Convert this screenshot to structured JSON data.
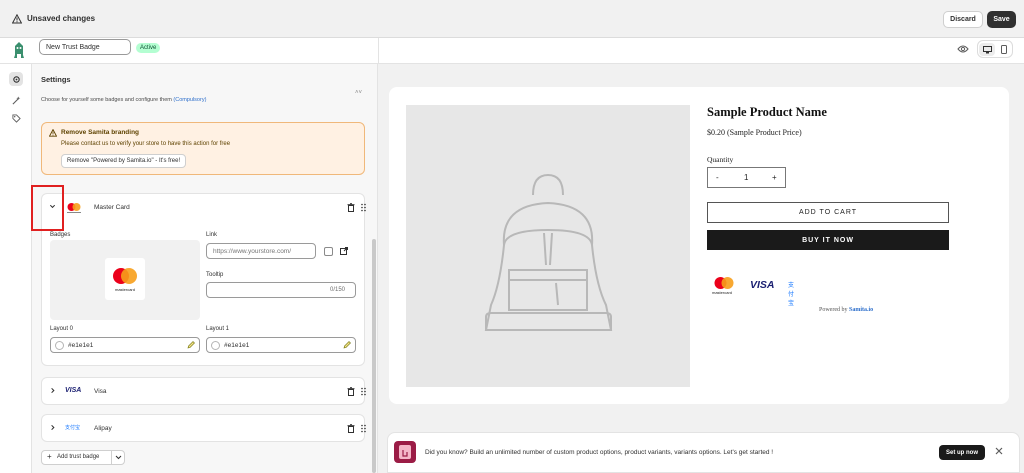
{
  "topbar": {
    "title": "Unsaved changes",
    "discard": "Discard",
    "save": "Save"
  },
  "header": {
    "name_value": "New Trust Badge",
    "status": "Active"
  },
  "rail": {
    "icons": [
      "gear-icon",
      "magic-icon",
      "tag-icon"
    ]
  },
  "settings": {
    "title": "Settings",
    "subtitle": "Choose for yourself some badges and configure them",
    "subtitle_link": "(Compulsory)",
    "notice": {
      "title": "Remove Samita branding",
      "message": "Please contact us to verify your store to have this action for free",
      "button": "Remove \"Powered by Samita.io\" - It's free!"
    },
    "badges": [
      {
        "name": "Master Card",
        "expanded": true,
        "badges_label": "Badges",
        "badge_caption": "mastercard",
        "link_label": "Link",
        "link_placeholder": "https://www.yourstore.com/",
        "tooltip_label": "Tooltip",
        "tooltip_counter": "0/150",
        "layout0_label": "Layout 0",
        "layout0_value": "#e1e1e1",
        "layout1_label": "Layout 1",
        "layout1_value": "#e1e1e1"
      },
      {
        "name": "Visa",
        "expanded": false,
        "logo_text": "VISA"
      },
      {
        "name": "Alipay",
        "expanded": false,
        "logo_text": "支付宝"
      }
    ],
    "add_button": "Add trust badge"
  },
  "preview": {
    "product_name": "Sample Product Name",
    "price": "$0.20 (Sample Product Price)",
    "quantity_label": "Quantity",
    "qty_minus": "-",
    "qty_value": "1",
    "qty_plus": "+",
    "add_to_cart": "ADD TO CART",
    "buy_now": "BUY IT NOW",
    "trust_badges": [
      "mastercard",
      "VISA",
      "支付宝"
    ],
    "powered_prefix": "Powered by",
    "powered_brand": "Samita.io"
  },
  "tip": {
    "text": "Did you know? Build an unlimited number of custom product options, product variants, variants options. Let's get started !",
    "button": "Set up now"
  },
  "colors": {
    "accent": "#303030",
    "active_bg": "#b4fed2",
    "notice_bg": "#fff1e3",
    "highlight": "#e02020",
    "mc_red": "#eb001b",
    "mc_orange": "#f79e1b",
    "visa_blue": "#1a1f71",
    "alipay_blue": "#1677ff"
  }
}
